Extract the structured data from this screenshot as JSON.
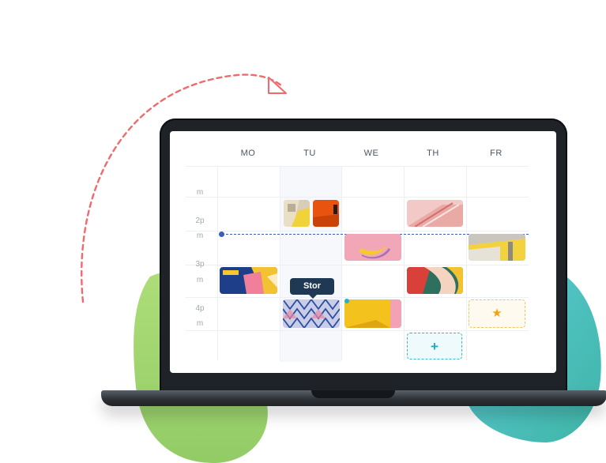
{
  "calendar": {
    "days": [
      "MO",
      "TU",
      "WE",
      "TH",
      "FR"
    ],
    "times": [
      {
        "top": "m"
      },
      {
        "line1": "2p",
        "line2": "m"
      },
      {
        "line1": "3p",
        "line2": "m"
      },
      {
        "line1": "4p",
        "line2": "m"
      }
    ],
    "tooltip": "Stor",
    "add_label": "+",
    "star_label": "★"
  },
  "colors": {
    "accent_blue": "#3b5bbf",
    "teal": "#28b3c8",
    "tooltip_bg": "#1f3854",
    "star": "#f2a218",
    "arrow": "#ef6b6b",
    "blob_green": "#9ed36a",
    "blob_teal": "#4cc3cc"
  },
  "icons": [
    "plus-icon",
    "star-icon"
  ]
}
